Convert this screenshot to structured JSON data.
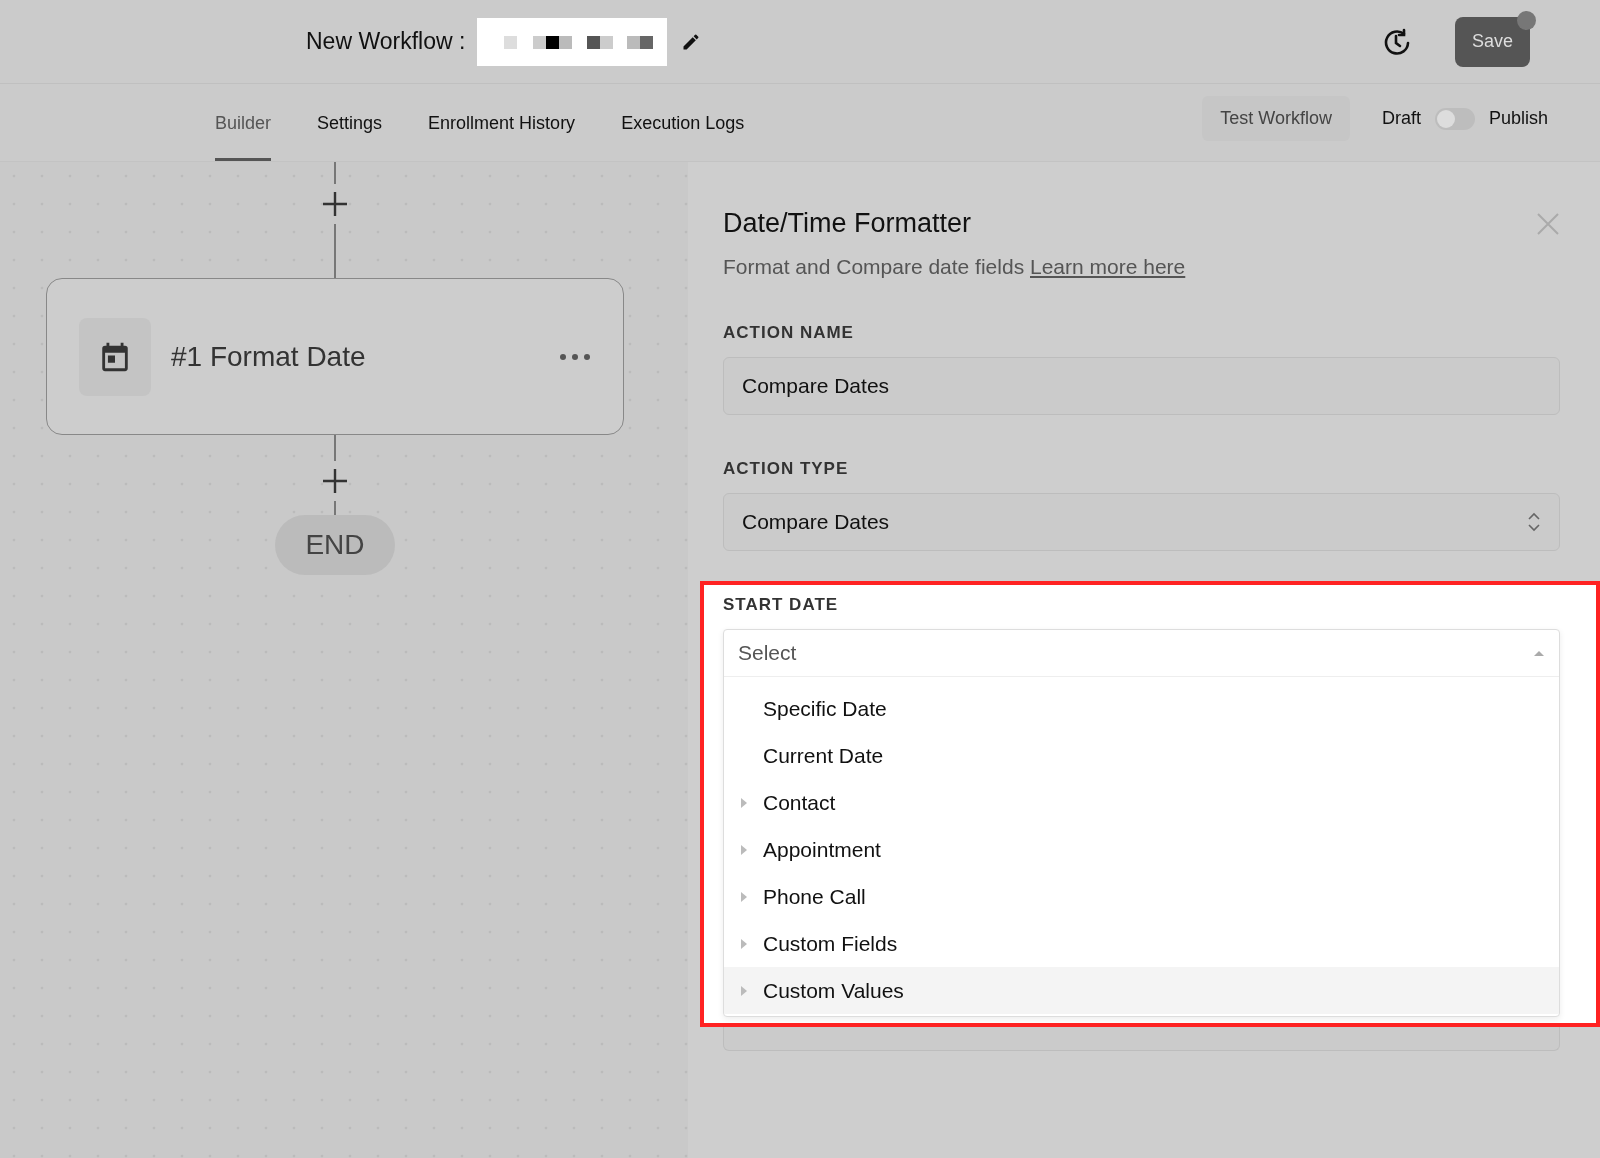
{
  "header": {
    "title": "New Workflow :",
    "save": "Save"
  },
  "tabs": [
    {
      "label": "Builder",
      "selected": true
    },
    {
      "label": "Settings",
      "selected": false
    },
    {
      "label": "Enrollment History",
      "selected": false
    },
    {
      "label": "Execution Logs",
      "selected": false
    }
  ],
  "test_button": "Test Workflow",
  "publish": {
    "off_label": "Draft",
    "on_label": "Publish",
    "on": false
  },
  "canvas": {
    "node": {
      "title": "#1 Format Date"
    },
    "end": "END"
  },
  "panel": {
    "title": "Date/Time Formatter",
    "subtitle": "Format and Compare date fields",
    "link": "Learn more here",
    "fields": [
      {
        "label": "ACTION NAME",
        "kind": "text",
        "value": "Compare Dates"
      },
      {
        "label": "ACTION TYPE",
        "kind": "select",
        "value": "Compare Dates"
      }
    ],
    "start_date": {
      "label": "START DATE",
      "placeholder": "Select",
      "expanded": true,
      "options": [
        {
          "label": "Specific Date",
          "has_children": false,
          "hovered": false
        },
        {
          "label": "Current Date",
          "has_children": false,
          "hovered": false
        },
        {
          "label": "Contact",
          "has_children": true,
          "hovered": false
        },
        {
          "label": "Appointment",
          "has_children": true,
          "hovered": false
        },
        {
          "label": "Phone Call",
          "has_children": true,
          "hovered": false
        },
        {
          "label": "Custom Fields",
          "has_children": true,
          "hovered": false
        },
        {
          "label": "Custom Values",
          "has_children": true,
          "hovered": true
        }
      ]
    }
  }
}
